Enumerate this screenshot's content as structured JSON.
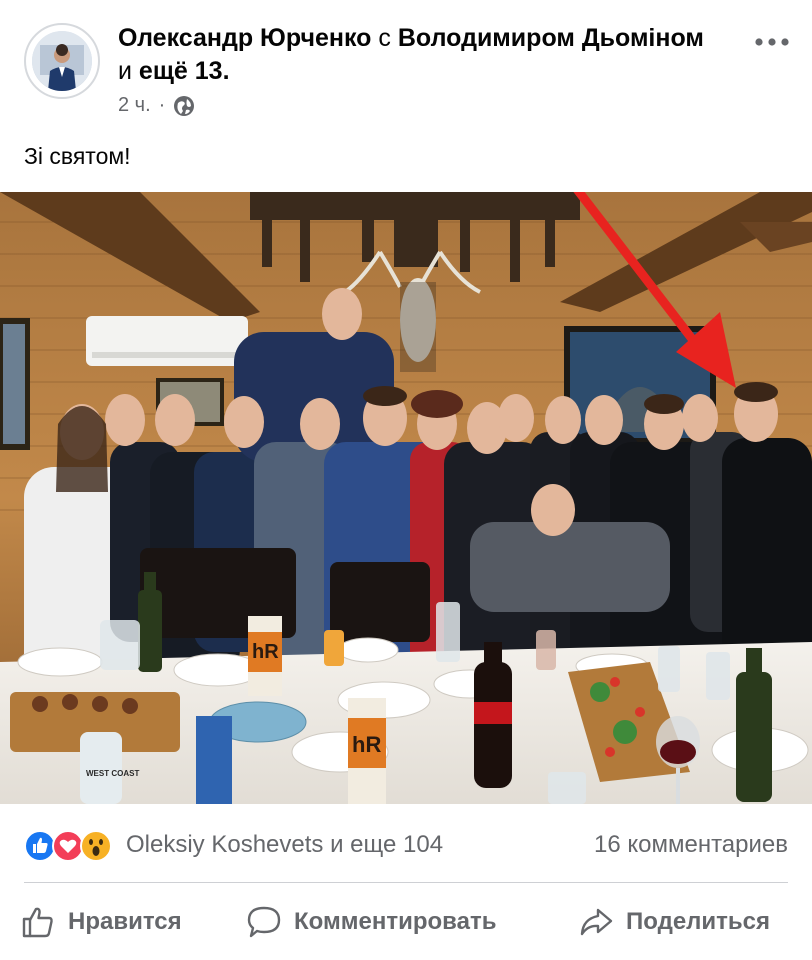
{
  "post": {
    "author": "Олександр Юрченко",
    "with_word": "с",
    "tagged_1": "Володимиром Дьоміном",
    "and_word": "и",
    "tagged_more": "ещё 13.",
    "time": "2 ч.",
    "separator": "·",
    "privacy_icon": "globe-icon",
    "text": "Зі святом!"
  },
  "photo": {
    "bottle_label_1": "hR",
    "bottle_label_2": "hR",
    "bottle_label_3": "WEST COAST"
  },
  "reactions": {
    "icons": [
      "like-icon",
      "love-icon",
      "wow-icon"
    ],
    "summary": "Oleksiy Koshevets и еще 104",
    "comments": "16 комментариев"
  },
  "actions": {
    "like": "Нравится",
    "comment": "Комментировать",
    "share": "Поделиться"
  },
  "colors": {
    "like_blue": "#1877f2",
    "love_red": "#f33e58",
    "wow_yellow": "#f7b125",
    "secondary_text": "#65676b",
    "arrow_red": "#e8231f"
  }
}
